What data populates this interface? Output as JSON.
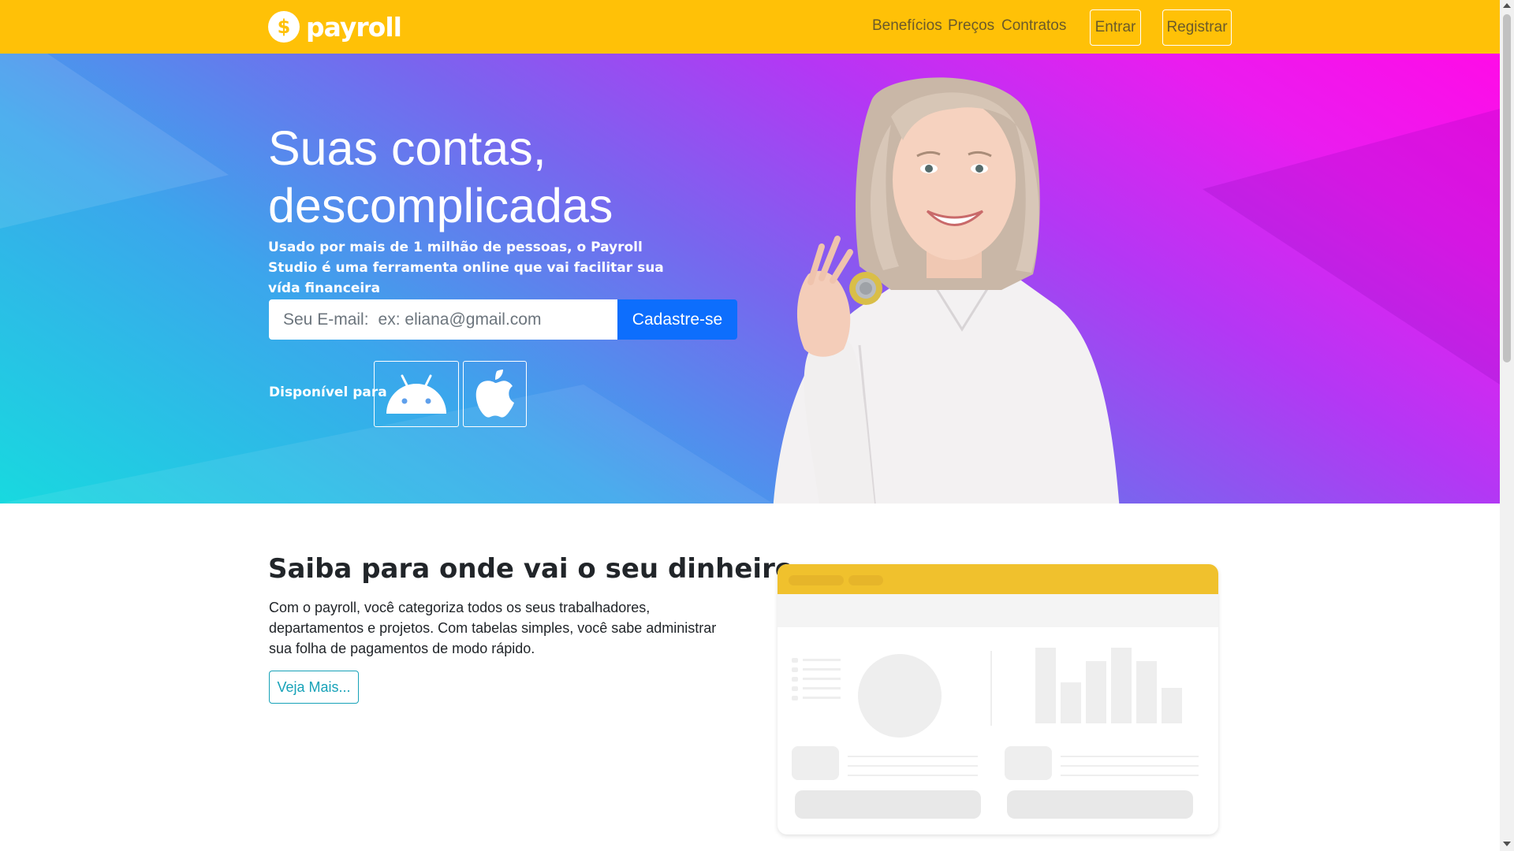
{
  "nav": {
    "logo_text": "payroll",
    "logo_symbol": "$",
    "links": [
      "Benefícios",
      "Preços",
      "Contratos"
    ],
    "login_label": "Entrar",
    "register_label": "Registrar"
  },
  "hero": {
    "headline_line1": "Suas contas,",
    "headline_line2": "descomplicadas",
    "subtitle": "Usado por mais de 1 milhão de pessoas, o Payroll Studio é uma ferramenta online que vai facilitar sua vída financeira",
    "email_label": "Seu E-mail:",
    "email_placeholder": "ex: eliana@gmail.com",
    "cta_label": "Cadastre-se",
    "available_label": "Disponível para",
    "stores": [
      {
        "icon": "android-icon"
      },
      {
        "icon": "apple-icon"
      }
    ]
  },
  "section": {
    "title": "Saiba para onde vai o seu dinheiro",
    "body": "Com o payroll, você categoriza todos os seus trabalhadores, departamentos e projetos. Com tabelas simples, você sabe administrar sua folha de pagamentos de modo rápido.",
    "more_label": "Veja Mais..."
  },
  "colors": {
    "nav": "#ffc107",
    "cta": "#0d6efd",
    "outline": "#17a2b8"
  }
}
